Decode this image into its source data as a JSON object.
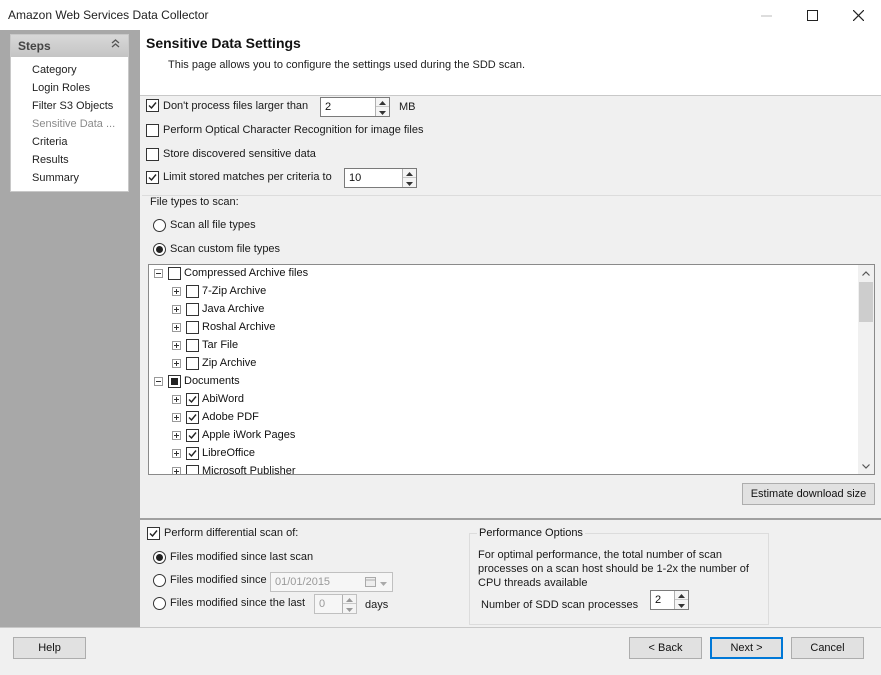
{
  "window": {
    "title": "Amazon Web Services Data Collector"
  },
  "steps": {
    "title": "Steps",
    "items": [
      {
        "label": "Category"
      },
      {
        "label": "Login Roles"
      },
      {
        "label": "Filter S3 Objects"
      },
      {
        "label": "Sensitive Data ..."
      },
      {
        "label": "Criteria"
      },
      {
        "label": "Results"
      },
      {
        "label": "Summary"
      }
    ]
  },
  "header": {
    "title": "Sensitive Data Settings",
    "description": "This page allows you to configure the settings used during the SDD scan."
  },
  "options": {
    "max_size": {
      "label": "Don't process files larger than",
      "value": "2",
      "unit": "MB",
      "checked": true
    },
    "ocr": {
      "label": "Perform Optical Character Recognition for image files",
      "checked": false
    },
    "store": {
      "label": "Store discovered sensitive data",
      "checked": false
    },
    "limit": {
      "label": "Limit stored matches per criteria to",
      "value": "10",
      "checked": true
    }
  },
  "file_types": {
    "group_label": "File types to scan:",
    "scan_all": "Scan all file types",
    "scan_custom": "Scan custom file types",
    "tree": [
      {
        "label": "Compressed Archive files",
        "level": 0,
        "state": "unchecked"
      },
      {
        "label": "7-Zip Archive",
        "level": 1,
        "state": "unchecked"
      },
      {
        "label": "Java Archive",
        "level": 1,
        "state": "unchecked"
      },
      {
        "label": "Roshal Archive",
        "level": 1,
        "state": "unchecked"
      },
      {
        "label": "Tar File",
        "level": 1,
        "state": "unchecked"
      },
      {
        "label": "Zip Archive",
        "level": 1,
        "state": "unchecked"
      },
      {
        "label": "Documents",
        "level": 0,
        "state": "partial"
      },
      {
        "label": "AbiWord",
        "level": 1,
        "state": "checked"
      },
      {
        "label": "Adobe PDF",
        "level": 1,
        "state": "checked"
      },
      {
        "label": "Apple iWork Pages",
        "level": 1,
        "state": "checked"
      },
      {
        "label": "LibreOffice",
        "level": 1,
        "state": "checked"
      },
      {
        "label": "Microsoft Publisher",
        "level": 1,
        "state": "unchecked"
      }
    ],
    "estimate_button": "Estimate download size"
  },
  "differential": {
    "label": "Perform differential scan of:",
    "checked": true,
    "opt_last_scan": "Files modified since last scan",
    "opt_since_date": "Files modified since",
    "date_value": "01/01/2015",
    "opt_since_last": "Files modified since the last",
    "days_value": "0",
    "days_unit": "days"
  },
  "performance": {
    "title": "Performance Options",
    "description": "For optimal performance, the total number of scan processes on a scan host should be 1-2x the number of CPU threads available",
    "processes_label": "Number of SDD scan processes",
    "processes_value": "2"
  },
  "footer": {
    "help": "Help",
    "back": "< Back",
    "next": "Next >",
    "cancel": "Cancel"
  },
  "icons": {
    "minimize": "minimize-icon",
    "maximize": "maximize-icon",
    "close": "close-icon",
    "collapse": "double-chevron-up-icon",
    "calendar": "calendar-icon"
  }
}
